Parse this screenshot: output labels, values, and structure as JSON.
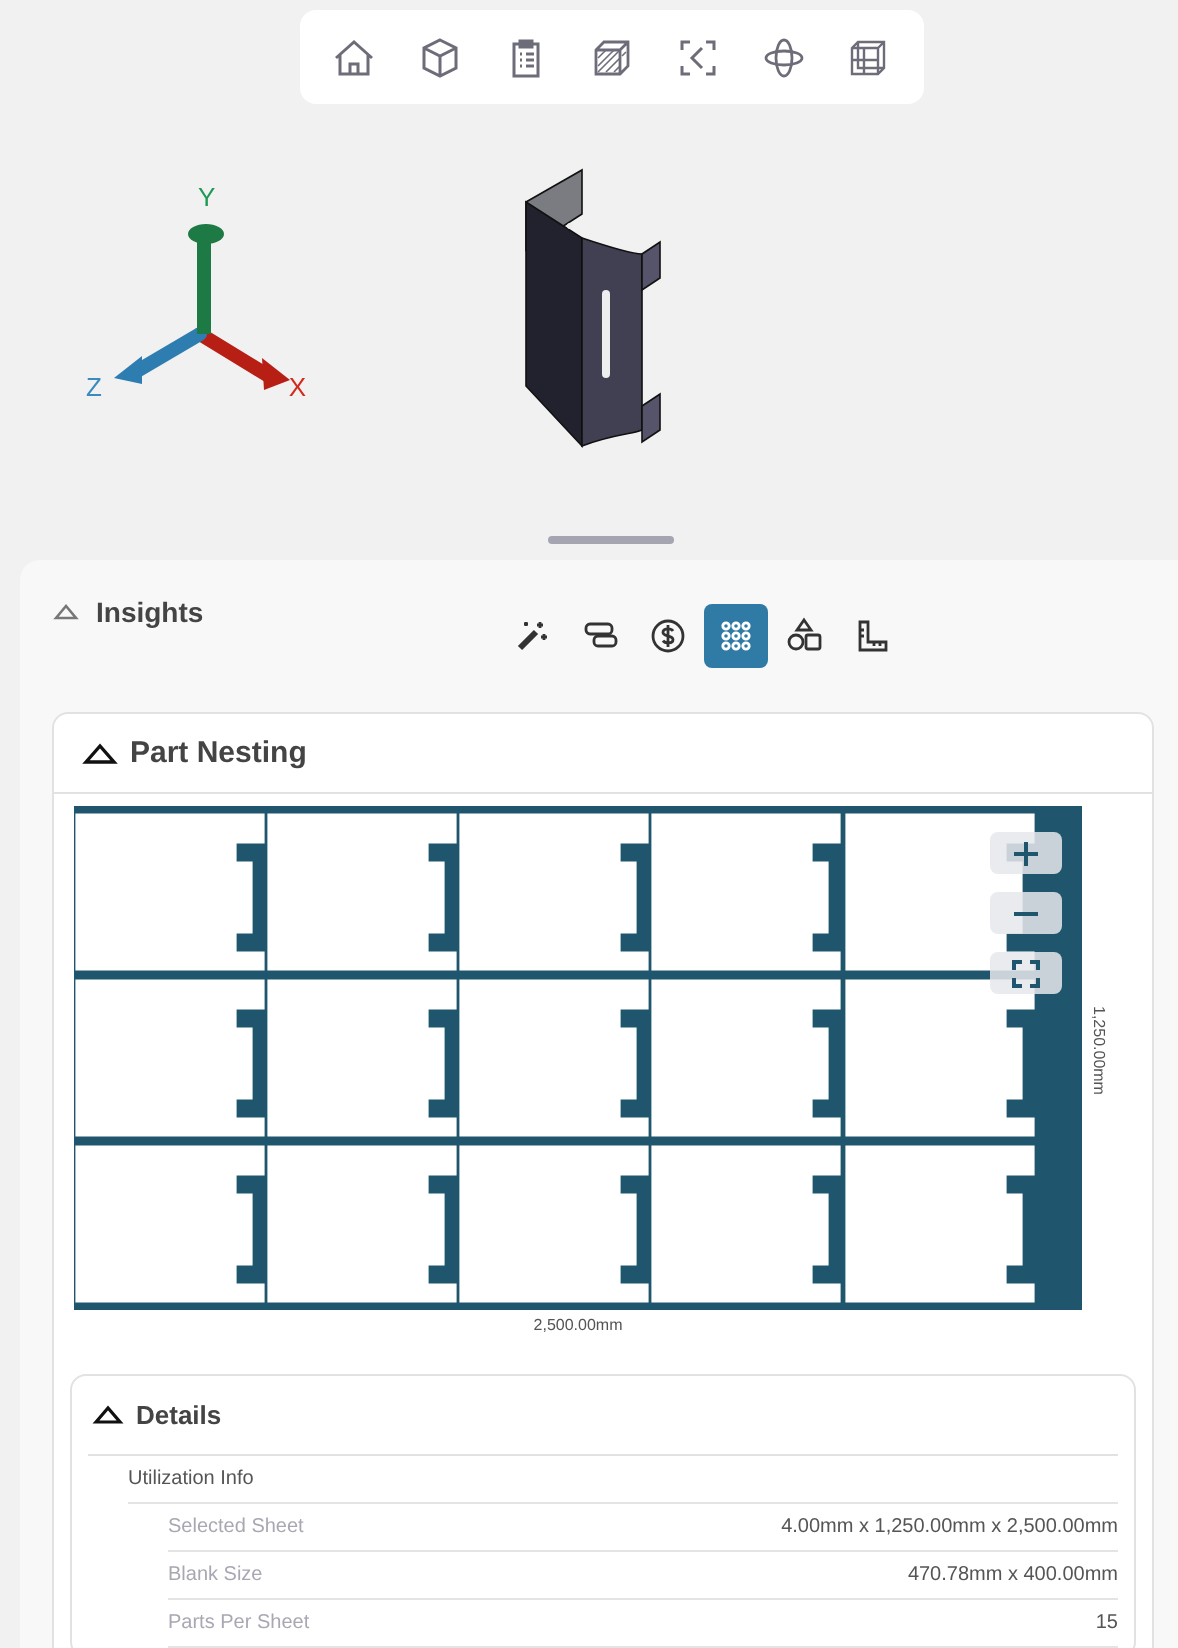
{
  "axes": {
    "x": "X",
    "y": "Y",
    "z": "Z"
  },
  "insights": {
    "title": "Insights",
    "expanded": true,
    "tabs": [
      {
        "kind": "wand",
        "selected": false
      },
      {
        "kind": "layers",
        "selected": false
      },
      {
        "kind": "cost",
        "selected": false
      },
      {
        "kind": "grid",
        "selected": true
      },
      {
        "kind": "shapes",
        "selected": false
      },
      {
        "kind": "ruler",
        "selected": false
      }
    ]
  },
  "nesting": {
    "title": "Part Nesting",
    "expanded": true,
    "width_label": "2,500.00mm",
    "height_label": "1,250.00mm"
  },
  "details": {
    "title": "Details",
    "expanded": true,
    "group": "Utilization Info",
    "rows": [
      {
        "label": "Selected Sheet",
        "value": "4.00mm x 1,250.00mm x 2,500.00mm"
      },
      {
        "label": "Blank Size",
        "value": "470.78mm x 400.00mm"
      },
      {
        "label": "Parts Per Sheet",
        "value": "15"
      }
    ]
  }
}
